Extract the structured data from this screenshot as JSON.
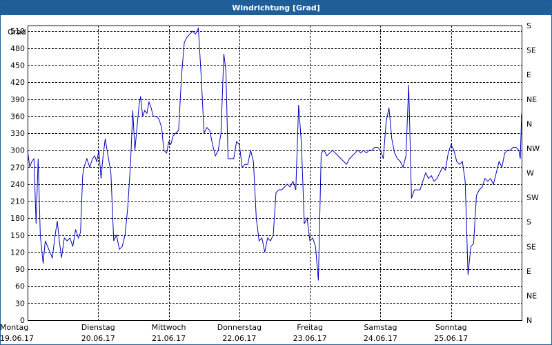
{
  "window": {
    "title": "Windrichtung [Grad]"
  },
  "chart_data": {
    "type": "line",
    "title": "Windrichtung [Grad]",
    "ylabel": "Grad",
    "ylim": [
      0,
      520
    ],
    "xlim": [
      0,
      7
    ],
    "grid": true,
    "y_ticks": [
      0,
      30,
      60,
      90,
      120,
      150,
      180,
      210,
      240,
      270,
      300,
      330,
      360,
      390,
      420,
      450,
      480,
      510
    ],
    "y2_ticks": [
      {
        "value": 0,
        "label": "N"
      },
      {
        "value": 45,
        "label": "NE"
      },
      {
        "value": 90,
        "label": "E"
      },
      {
        "value": 135,
        "label": "SE"
      },
      {
        "value": 180,
        "label": "S"
      },
      {
        "value": 225,
        "label": "SW"
      },
      {
        "value": 270,
        "label": "W"
      },
      {
        "value": 315,
        "label": "NW"
      },
      {
        "value": 360,
        "label": "N"
      },
      {
        "value": 405,
        "label": "NE"
      },
      {
        "value": 450,
        "label": "E"
      },
      {
        "value": 495,
        "label": "SE"
      },
      {
        "value": 540,
        "label": "S"
      }
    ],
    "x_ticks": [
      {
        "value": 0,
        "day": "Montag",
        "date": "19.06.17"
      },
      {
        "value": 1,
        "day": "Dienstag",
        "date": "20.06.17"
      },
      {
        "value": 2,
        "day": "Mittwoch",
        "date": "21.06.17"
      },
      {
        "value": 3,
        "day": "Donnerstag",
        "date": "22.06.17"
      },
      {
        "value": 4,
        "day": "Freitag",
        "date": "23.06.17"
      },
      {
        "value": 5,
        "day": "Samstag",
        "date": "24.06.17"
      },
      {
        "value": 6,
        "day": "Sonntag",
        "date": "25.06.17"
      }
    ],
    "series": [
      {
        "color": "#0000c0",
        "points": [
          [
            0,
            300
          ],
          [
            0.03,
            270
          ],
          [
            0.06,
            280
          ],
          [
            0.09,
            285
          ],
          [
            0.12,
            170
          ],
          [
            0.15,
            285
          ],
          [
            0.18,
            150
          ],
          [
            0.22,
            100
          ],
          [
            0.25,
            140
          ],
          [
            0.3,
            125
          ],
          [
            0.35,
            110
          ],
          [
            0.39,
            150
          ],
          [
            0.42,
            175
          ],
          [
            0.45,
            140
          ],
          [
            0.48,
            110
          ],
          [
            0.52,
            145
          ],
          [
            0.56,
            140
          ],
          [
            0.6,
            145
          ],
          [
            0.64,
            130
          ],
          [
            0.68,
            160
          ],
          [
            0.72,
            145
          ],
          [
            0.75,
            155
          ],
          [
            0.78,
            255
          ],
          [
            0.8,
            270
          ],
          [
            0.84,
            285
          ],
          [
            0.88,
            270
          ],
          [
            0.92,
            285
          ],
          [
            0.95,
            290
          ],
          [
            0.98,
            280
          ],
          [
            1.01,
            300
          ],
          [
            1.04,
            250
          ],
          [
            1.07,
            290
          ],
          [
            1.1,
            320
          ],
          [
            1.14,
            290
          ],
          [
            1.18,
            260
          ],
          [
            1.22,
            140
          ],
          [
            1.26,
            150
          ],
          [
            1.3,
            125
          ],
          [
            1.34,
            130
          ],
          [
            1.38,
            150
          ],
          [
            1.42,
            200
          ],
          [
            1.46,
            280
          ],
          [
            1.49,
            370
          ],
          [
            1.52,
            300
          ],
          [
            1.55,
            340
          ],
          [
            1.58,
            380
          ],
          [
            1.6,
            395
          ],
          [
            1.63,
            360
          ],
          [
            1.66,
            370
          ],
          [
            1.69,
            365
          ],
          [
            1.72,
            385
          ],
          [
            1.75,
            375
          ],
          [
            1.78,
            360
          ],
          [
            1.82,
            360
          ],
          [
            1.86,
            355
          ],
          [
            1.9,
            340
          ],
          [
            1.93,
            300
          ],
          [
            1.97,
            295
          ],
          [
            2.0,
            315
          ],
          [
            2.03,
            310
          ],
          [
            2.06,
            325
          ],
          [
            2.1,
            330
          ],
          [
            2.14,
            335
          ],
          [
            2.18,
            430
          ],
          [
            2.22,
            490
          ],
          [
            2.26,
            500
          ],
          [
            2.3,
            505
          ],
          [
            2.34,
            510
          ],
          [
            2.38,
            505
          ],
          [
            2.42,
            515
          ],
          [
            2.46,
            430
          ],
          [
            2.5,
            330
          ],
          [
            2.54,
            340
          ],
          [
            2.58,
            335
          ],
          [
            2.62,
            310
          ],
          [
            2.66,
            290
          ],
          [
            2.7,
            300
          ],
          [
            2.74,
            330
          ],
          [
            2.78,
            470
          ],
          [
            2.81,
            440
          ],
          [
            2.84,
            285
          ],
          [
            2.88,
            285
          ],
          [
            2.92,
            285
          ],
          [
            2.96,
            315
          ],
          [
            3.0,
            310
          ],
          [
            3.04,
            270
          ],
          [
            3.08,
            275
          ],
          [
            3.12,
            275
          ],
          [
            3.16,
            300
          ],
          [
            3.2,
            280
          ],
          [
            3.24,
            180
          ],
          [
            3.28,
            140
          ],
          [
            3.32,
            145
          ],
          [
            3.36,
            120
          ],
          [
            3.4,
            145
          ],
          [
            3.44,
            140
          ],
          [
            3.48,
            150
          ],
          [
            3.52,
            225
          ],
          [
            3.56,
            230
          ],
          [
            3.6,
            230
          ],
          [
            3.64,
            235
          ],
          [
            3.68,
            240
          ],
          [
            3.72,
            235
          ],
          [
            3.76,
            245
          ],
          [
            3.8,
            230
          ],
          [
            3.84,
            380
          ],
          [
            3.88,
            310
          ],
          [
            3.92,
            170
          ],
          [
            3.96,
            180
          ],
          [
            4.0,
            140
          ],
          [
            4.04,
            145
          ],
          [
            4.08,
            130
          ],
          [
            4.12,
            70
          ],
          [
            4.16,
            295
          ],
          [
            4.2,
            300
          ],
          [
            4.24,
            290
          ],
          [
            4.28,
            295
          ],
          [
            4.32,
            300
          ],
          [
            4.36,
            295
          ],
          [
            4.4,
            290
          ],
          [
            4.44,
            285
          ],
          [
            4.48,
            280
          ],
          [
            4.52,
            275
          ],
          [
            4.56,
            285
          ],
          [
            4.6,
            290
          ],
          [
            4.64,
            295
          ],
          [
            4.68,
            300
          ],
          [
            4.72,
            295
          ],
          [
            4.76,
            300
          ],
          [
            4.8,
            295
          ],
          [
            4.84,
            300
          ],
          [
            4.88,
            300
          ],
          [
            4.92,
            305
          ],
          [
            4.96,
            305
          ],
          [
            5.0,
            300
          ],
          [
            5.04,
            285
          ],
          [
            5.08,
            350
          ],
          [
            5.12,
            375
          ],
          [
            5.16,
            320
          ],
          [
            5.2,
            295
          ],
          [
            5.24,
            285
          ],
          [
            5.28,
            280
          ],
          [
            5.32,
            270
          ],
          [
            5.36,
            290
          ],
          [
            5.4,
            415
          ],
          [
            5.44,
            215
          ],
          [
            5.48,
            230
          ],
          [
            5.52,
            230
          ],
          [
            5.56,
            230
          ],
          [
            5.6,
            245
          ],
          [
            5.64,
            260
          ],
          [
            5.68,
            250
          ],
          [
            5.72,
            255
          ],
          [
            5.76,
            245
          ],
          [
            5.8,
            250
          ],
          [
            5.84,
            260
          ],
          [
            5.88,
            270
          ],
          [
            5.92,
            265
          ],
          [
            5.96,
            295
          ],
          [
            6.0,
            310
          ],
          [
            6.04,
            300
          ],
          [
            6.08,
            280
          ],
          [
            6.12,
            275
          ],
          [
            6.16,
            280
          ],
          [
            6.2,
            245
          ],
          [
            6.24,
            80
          ],
          [
            6.28,
            130
          ],
          [
            6.32,
            135
          ],
          [
            6.36,
            220
          ],
          [
            6.4,
            230
          ],
          [
            6.44,
            235
          ],
          [
            6.48,
            250
          ],
          [
            6.52,
            245
          ],
          [
            6.56,
            250
          ],
          [
            6.6,
            240
          ],
          [
            6.64,
            260
          ],
          [
            6.68,
            280
          ],
          [
            6.72,
            270
          ],
          [
            6.76,
            295
          ],
          [
            6.8,
            300
          ],
          [
            6.84,
            300
          ],
          [
            6.88,
            305
          ],
          [
            6.92,
            305
          ],
          [
            6.96,
            300
          ],
          [
            6.98,
            285
          ],
          [
            7.0,
            365
          ]
        ]
      }
    ]
  }
}
